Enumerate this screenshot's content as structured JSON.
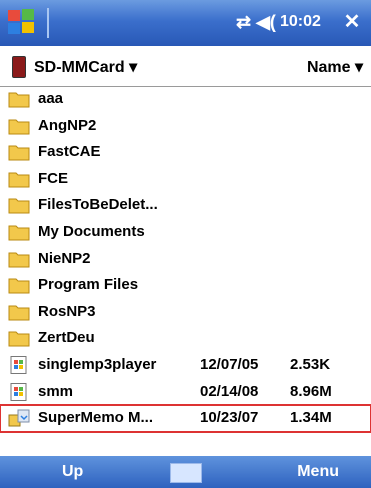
{
  "statusbar": {
    "time": "10:02",
    "icons": [
      "start-icon",
      "connectivity-icon",
      "volume-icon",
      "close-icon"
    ]
  },
  "header": {
    "location": "SD-MMCard",
    "sort": "Name"
  },
  "files": [
    {
      "name": "aaa",
      "type": "folder"
    },
    {
      "name": "AngNP2",
      "type": "folder"
    },
    {
      "name": "FastCAE",
      "type": "folder"
    },
    {
      "name": "FCE",
      "type": "folder"
    },
    {
      "name": "FilesToBeDelet...",
      "type": "folder"
    },
    {
      "name": "My Documents",
      "type": "folder"
    },
    {
      "name": "NieNP2",
      "type": "folder"
    },
    {
      "name": "Program Files",
      "type": "folder"
    },
    {
      "name": "RosNP3",
      "type": "folder"
    },
    {
      "name": "ZertDeu",
      "type": "folder"
    },
    {
      "name": "singlemp3player",
      "type": "app",
      "date": "12/07/05",
      "size": "2.53K"
    },
    {
      "name": "smm",
      "type": "app",
      "date": "02/14/08",
      "size": "8.96M"
    },
    {
      "name": "SuperMemo M...",
      "type": "installer",
      "date": "10/23/07",
      "size": "1.34M",
      "selected": true
    }
  ],
  "softkeys": {
    "left": "Up",
    "right": "Menu"
  },
  "colors": {
    "title_bar": "#3b6fcc",
    "selection_outline": "#dd3333",
    "folder": "#f2c84b"
  }
}
